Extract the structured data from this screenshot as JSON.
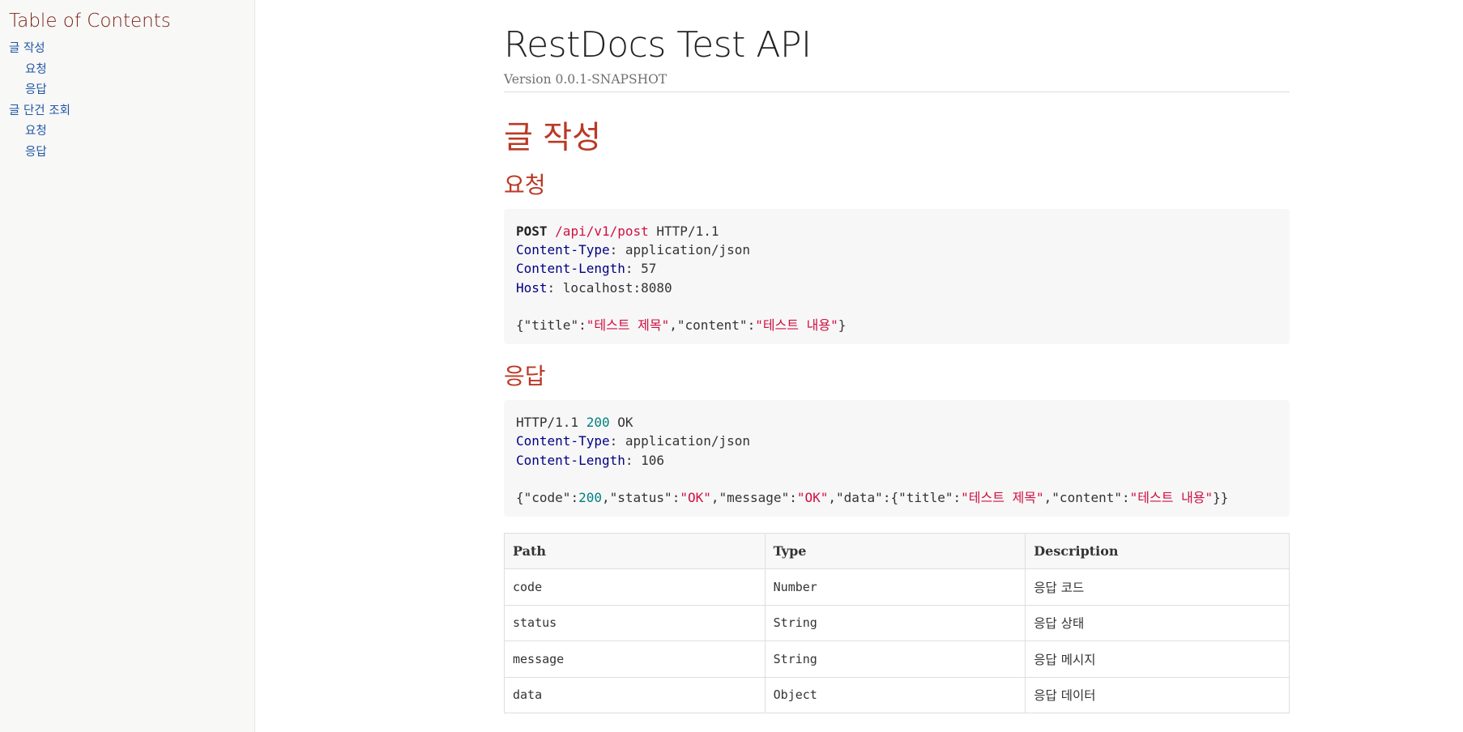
{
  "toc": {
    "title": "Table of Contents",
    "items": [
      {
        "label": "글 작성",
        "level": 1
      },
      {
        "label": "요청",
        "level": 2
      },
      {
        "label": "응답",
        "level": 2
      },
      {
        "label": "글 단건 조회",
        "level": 1
      },
      {
        "label": "요청",
        "level": 2
      },
      {
        "label": "응답",
        "level": 2
      }
    ]
  },
  "header": {
    "title": "RestDocs Test API",
    "version": "Version 0.0.1-SNAPSHOT"
  },
  "section": {
    "title": "글 작성",
    "request": {
      "heading": "요청",
      "method": "POST",
      "path": "/api/v1/post",
      "protocol": "HTTP/1.1",
      "headers": [
        {
          "name": "Content-Type",
          "value": "application/json"
        },
        {
          "name": "Content-Length",
          "value": "57"
        },
        {
          "name": "Host",
          "value": "localhost:8080"
        }
      ],
      "body": {
        "title_key": "\"title\"",
        "title_val": "\"테스트 제목\"",
        "content_key": "\"content\"",
        "content_val": "\"테스트 내용\""
      }
    },
    "response": {
      "heading": "응답",
      "protocol": "HTTP/1.1",
      "status_code": "200",
      "status_text": "OK",
      "headers": [
        {
          "name": "Content-Type",
          "value": "application/json"
        },
        {
          "name": "Content-Length",
          "value": "106"
        }
      ],
      "body": {
        "code_key": "\"code\"",
        "code_val": "200",
        "status_key": "\"status\"",
        "status_val": "\"OK\"",
        "message_key": "\"message\"",
        "message_val": "\"OK\"",
        "data_key": "\"data\"",
        "title_key": "\"title\"",
        "title_val": "\"테스트 제목\"",
        "content_key": "\"content\"",
        "content_val": "\"테스트 내용\""
      }
    },
    "fields_table": {
      "headers": [
        "Path",
        "Type",
        "Description"
      ],
      "rows": [
        [
          "code",
          "Number",
          "응답 코드"
        ],
        [
          "status",
          "String",
          "응답 상태"
        ],
        [
          "message",
          "String",
          "응답 메시지"
        ],
        [
          "data",
          "Object",
          "응답 데이터"
        ]
      ]
    }
  },
  "colors": {
    "heading": "#ba3925",
    "toc_title": "#7a2518",
    "link": "#2156a5",
    "code_string": "#d01040",
    "code_key": "#000080",
    "code_number": "#008080"
  }
}
